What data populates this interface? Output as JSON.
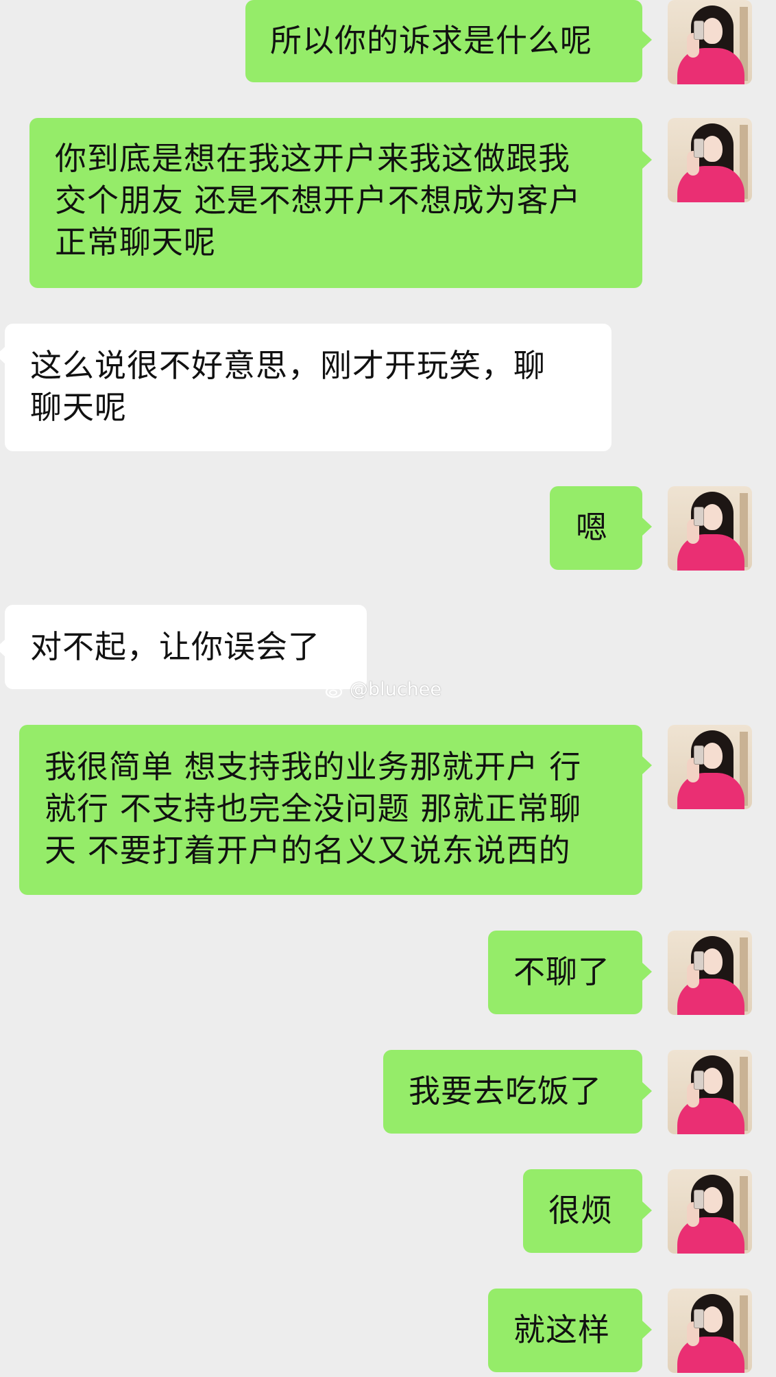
{
  "watermark": "@bluchee",
  "messages": [
    {
      "side": "out",
      "text": "所以你的诉求是什么呢"
    },
    {
      "side": "out",
      "text": "你到底是想在我这开户来我这做跟我\n交个朋友 还是不想开户不想成为客户\n正常聊天呢"
    },
    {
      "side": "in",
      "text": "这么说很不好意思，刚才开玩笑，聊\n聊天呢"
    },
    {
      "side": "out",
      "text": "嗯"
    },
    {
      "side": "in",
      "text": "对不起，让你误会了"
    },
    {
      "side": "out",
      "text": "我很简单 想支持我的业务那就开户 行\n就行 不支持也完全没问题 那就正常聊\n天 不要打着开户的名义又说东说西的"
    },
    {
      "side": "out",
      "text": "不聊了"
    },
    {
      "side": "out",
      "text": "我要去吃饭了"
    },
    {
      "side": "out",
      "text": "很烦"
    },
    {
      "side": "out",
      "text": "就这样"
    }
  ],
  "colors": {
    "background": "#ededed",
    "outgoing_bubble": "#95ec69",
    "incoming_bubble": "#ffffff",
    "text": "#111111"
  }
}
